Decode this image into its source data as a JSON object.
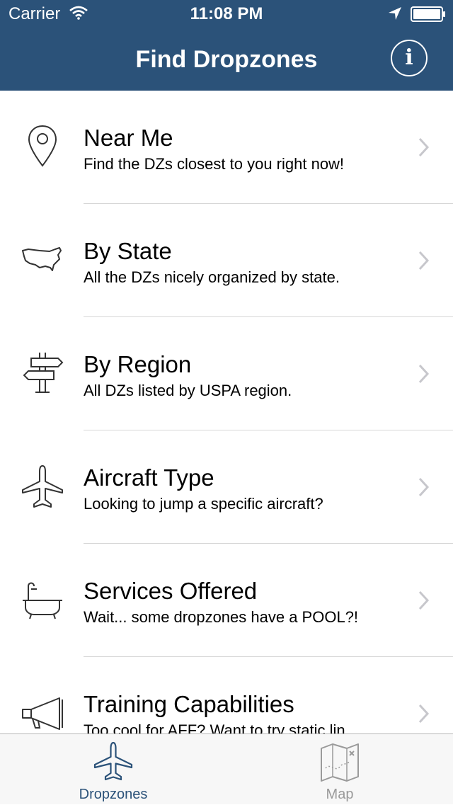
{
  "status_bar": {
    "carrier": "Carrier",
    "time": "11:08 PM"
  },
  "nav": {
    "title": "Find Dropzones",
    "info_glyph": "i"
  },
  "rows": [
    {
      "icon": "map-pin-icon",
      "title": "Near Me",
      "subtitle": "Find the DZs closest to you right now!"
    },
    {
      "icon": "usa-map-icon",
      "title": "By State",
      "subtitle": "All the DZs nicely organized by state."
    },
    {
      "icon": "signpost-icon",
      "title": "By Region",
      "subtitle": "All DZs listed by USPA region."
    },
    {
      "icon": "airplane-icon",
      "title": "Aircraft Type",
      "subtitle": "Looking to jump a specific aircraft?"
    },
    {
      "icon": "bathtub-icon",
      "title": "Services Offered",
      "subtitle": "Wait... some dropzones have a POOL?!"
    },
    {
      "icon": "megaphone-icon",
      "title": "Training Capabilities",
      "subtitle": "Too cool for AFF? Want to try static lin..."
    }
  ],
  "tabbar": {
    "tabs": [
      {
        "label": "Dropzones",
        "icon": "airplane-icon",
        "selected": true
      },
      {
        "label": "Map",
        "icon": "map-icon",
        "selected": false
      }
    ]
  },
  "colors": {
    "header_bg": "#2b5279",
    "tab_selected": "#2b5279",
    "tab_unselected": "#9a9a9a",
    "separator": "#d6d6d6",
    "chevron": "#c7c7cc",
    "icon_stroke": "#333333"
  }
}
